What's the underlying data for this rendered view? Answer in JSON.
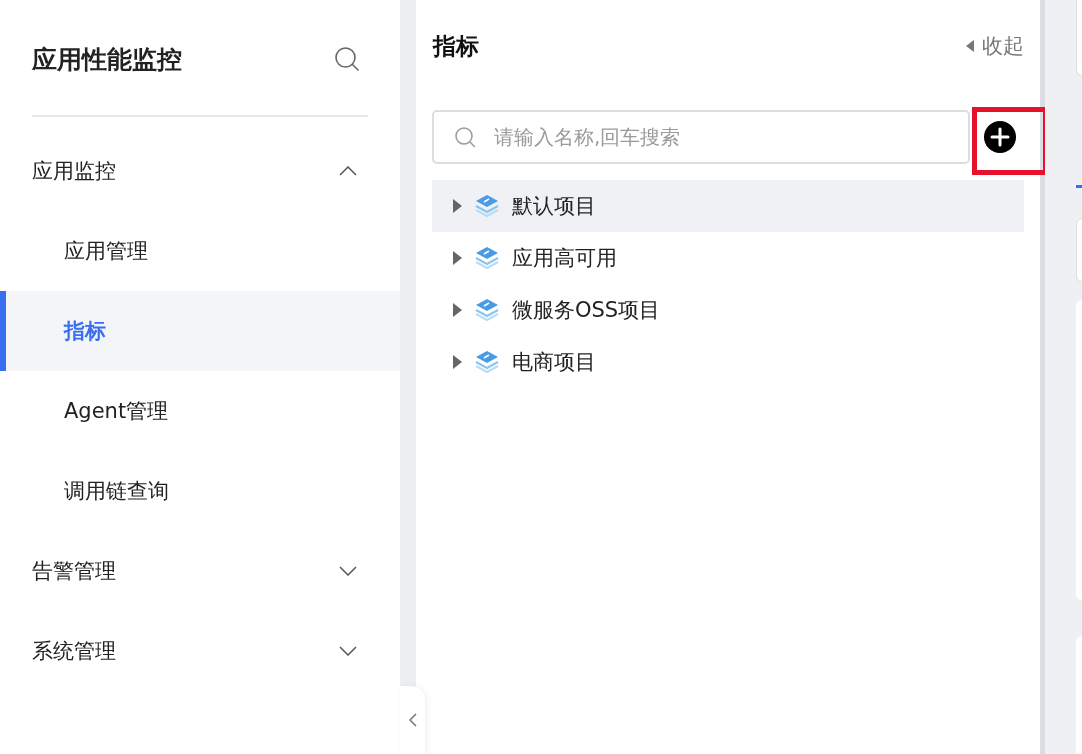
{
  "sidebar": {
    "title": "应用性能监控",
    "menu": [
      {
        "label": "应用监控",
        "expanded": true,
        "children": [
          {
            "label": "应用管理",
            "selected": false
          },
          {
            "label": "指标",
            "selected": true
          },
          {
            "label": "Agent管理",
            "selected": false
          },
          {
            "label": "调用链查询",
            "selected": false
          }
        ]
      },
      {
        "label": "告警管理",
        "expanded": false
      },
      {
        "label": "系统管理",
        "expanded": false
      }
    ]
  },
  "panel": {
    "title": "指标",
    "collapse": "收起",
    "search": {
      "placeholder": "请输入名称,回车搜索"
    },
    "tree": [
      {
        "label": "默认项目",
        "selected": true,
        "expanded": false
      },
      {
        "label": "应用高可用",
        "selected": false,
        "expanded": false
      },
      {
        "label": "微服务OSS项目",
        "selected": false,
        "expanded": false
      },
      {
        "label": "电商项目",
        "selected": false,
        "expanded": false
      }
    ]
  }
}
